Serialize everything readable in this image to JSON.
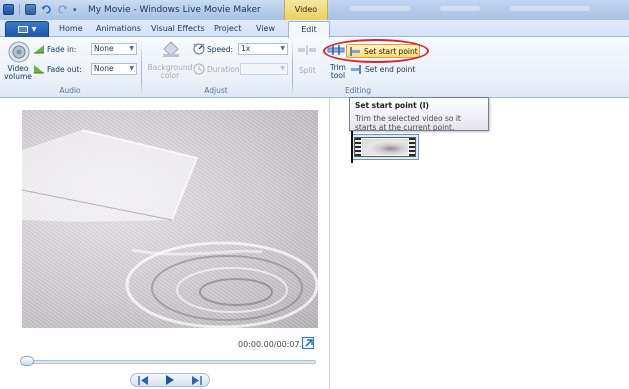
{
  "window": {
    "title": "My Movie - Windows Live Movie Maker",
    "context_tab_group": "Video Tools"
  },
  "tabs": {
    "items": [
      "Home",
      "Animations",
      "Visual Effects",
      "Project",
      "View"
    ],
    "active": "Edit"
  },
  "ribbon": {
    "audio": {
      "group_label": "Audio",
      "video_volume_label": "Video volume",
      "fade_in_label": "Fade in:",
      "fade_in_value": "None",
      "fade_out_label": "Fade out:",
      "fade_out_value": "None"
    },
    "adjust": {
      "group_label": "Adjust",
      "background_color_label": "Background color",
      "speed_label": "Speed:",
      "speed_value": "1x",
      "duration_label": "Duration:",
      "duration_value": ""
    },
    "editing": {
      "group_label": "Editing",
      "split_label": "Split",
      "trim_tool_label": "Trim tool",
      "set_start_point_label": "Set start point",
      "set_end_point_label": "Set end point"
    }
  },
  "tooltip": {
    "title": "Set start point (I)",
    "body": "Trim the selected video so it starts at the current point."
  },
  "preview": {
    "timecode": "00:00.00/00:07.47",
    "seek_position_fraction": 0.0
  },
  "colors": {
    "highlight_oval": "#d8262a",
    "context_tab": "#e9cf63",
    "accent_blue": "#1e56a8"
  },
  "icons": {
    "app": "app-icon",
    "save": "save-icon",
    "undo": "undo-icon",
    "redo": "redo-icon",
    "video_volume": "speaker-icon",
    "fade_in": "fade-in-icon",
    "fade_out": "fade-out-icon",
    "background_color": "paint-bucket-icon",
    "speed": "speed-icon",
    "duration": "clock-icon",
    "split": "split-icon",
    "trim_tool": "trim-icon",
    "set_start_point": "set-start-icon",
    "set_end_point": "set-end-icon",
    "popout": "expand-icon",
    "prev_frame": "previous-frame-icon",
    "play": "play-icon",
    "next_frame": "next-frame-icon"
  }
}
